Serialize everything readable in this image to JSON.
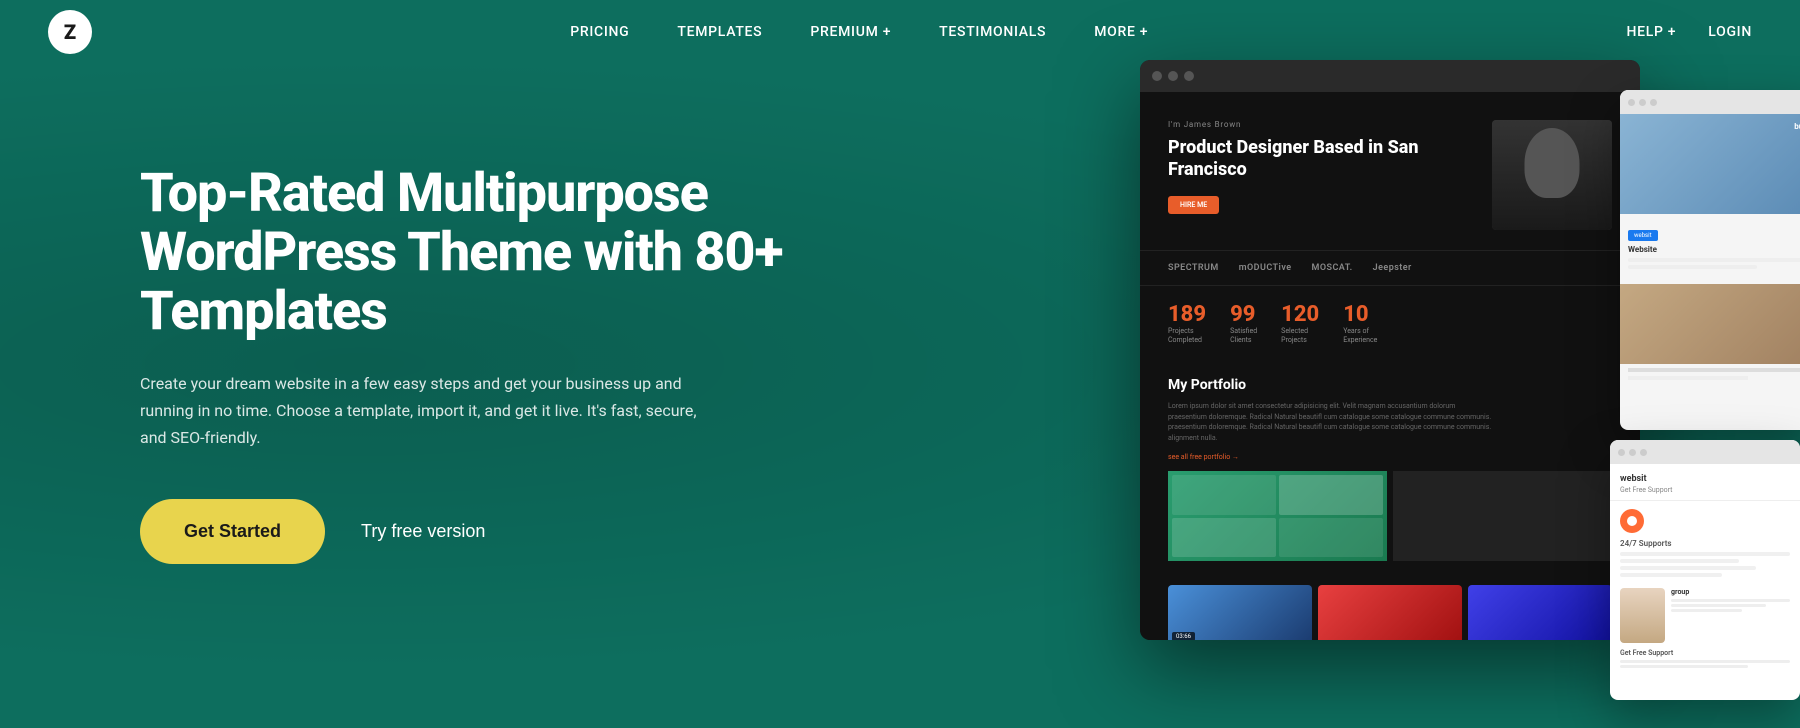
{
  "brand": {
    "logo_letter": "Z"
  },
  "nav": {
    "center_items": [
      {
        "label": "PRICING",
        "has_plus": false
      },
      {
        "label": "TEMPLATES",
        "has_plus": false
      },
      {
        "label": "PREMIUM +",
        "has_plus": true
      },
      {
        "label": "TESTIMONIALS",
        "has_plus": false
      },
      {
        "label": "MORE +",
        "has_plus": true
      }
    ],
    "right_items": [
      {
        "label": "HELP +"
      },
      {
        "label": "LOGIN"
      }
    ]
  },
  "hero": {
    "title": "Top-Rated Multipurpose WordPress Theme with 80+ Templates",
    "subtitle": "Create your dream website in a few easy steps and get your business up and running in no time. Choose a template, import it, and get it live. It's fast, secure, and SEO-friendly.",
    "cta_primary": "Get Started",
    "cta_secondary": "Try free version"
  },
  "inner_browser": {
    "eyebrow": "I'm James Brown",
    "title": "Product Designer Based in San Francisco",
    "cta": "HIRE ME",
    "logos": [
      "SPECTRUM",
      "mODUCTive",
      "MOSCAT.",
      "Jeepster"
    ],
    "stats": [
      {
        "num": "189",
        "label": "Projects\nCompleted"
      },
      {
        "num": "99",
        "label": "Satisfied\nClients"
      },
      {
        "num": "120",
        "label": "Selected\nProjects"
      },
      {
        "num": "10",
        "label": "Years of\nExperience"
      }
    ],
    "portfolio_title": "My Portfolio",
    "link_text": "see all free portfolio →"
  },
  "secondary1": {
    "tag": "Build",
    "title": "websit"
  },
  "secondary2": {
    "support_title": "24/7 Supports",
    "free_support": "Get Free Support",
    "person_name": "group"
  }
}
